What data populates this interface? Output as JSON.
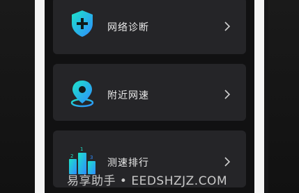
{
  "menu": {
    "items": [
      {
        "label": "网络诊断",
        "icon": "shield-plus-icon"
      },
      {
        "label": "附近网速",
        "icon": "location-pin-icon"
      },
      {
        "label": "测速排行",
        "icon": "podium-ranking-icon"
      }
    ]
  },
  "watermark": {
    "text": "易享助手 • EEDSHZJZ.COM"
  },
  "colors": {
    "card": "#252528",
    "icon_gradient_start": "#1de3c8",
    "icon_gradient_end": "#2f8cff"
  }
}
